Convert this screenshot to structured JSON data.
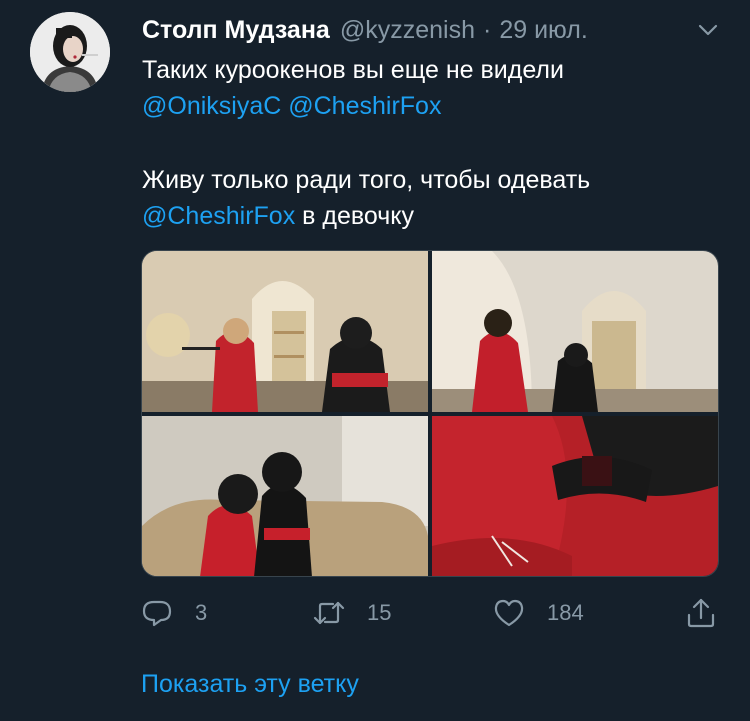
{
  "author": {
    "name": "Столп Мудзана",
    "handle": "@kyzzenish",
    "separator": "·",
    "date": "29 июл."
  },
  "tweet": {
    "line1": "Таких куроокенов вы еще не видели",
    "mention1": "@OniksiyaC",
    "mention2": "@CheshirFox",
    "line3": "Живу только ради того, чтобы одевать",
    "mention3": "@CheshirFox",
    "line4_tail": "в девочку"
  },
  "actions": {
    "reply_count": "3",
    "retweet_count": "15",
    "like_count": "184"
  },
  "thread_link": "Показать эту ветку",
  "icons": {
    "menu": "chevron-down-icon",
    "reply": "reply-icon",
    "retweet": "retweet-icon",
    "like": "heart-icon",
    "share": "share-icon"
  },
  "colors": {
    "background": "#15202b",
    "link": "#1da1f2",
    "secondary_text": "#8899a6",
    "primary_text": "#ffffff"
  }
}
